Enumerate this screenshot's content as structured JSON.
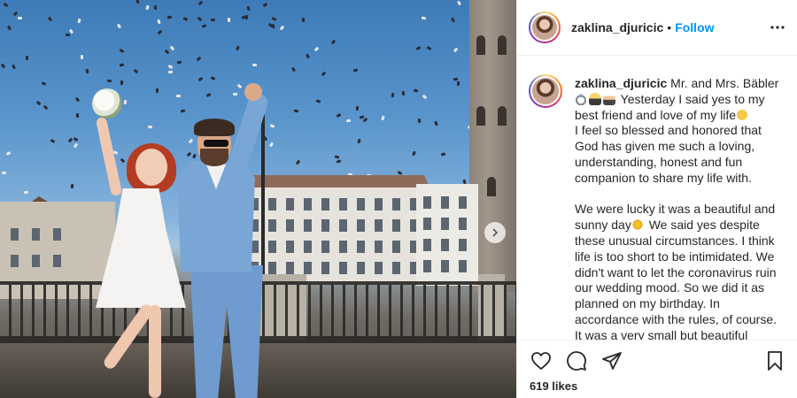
{
  "post": {
    "photo_alt": "",
    "author": {
      "username": "zaklina_djuricic",
      "separator": "•",
      "follow_label": "Follow"
    },
    "caption": {
      "username": "zaklina_djuricic",
      "line_1": "Mr. and Mrs. Bäbler",
      "line_2": "Yesterday I said yes to my best friend and love of my life",
      "line_3": "I feel so blessed and honored that God has given me such a loving, understanding, honest and fun companion to share my life with.",
      "line_4a": "We were lucky it was a beautiful and sunny day",
      "line_4b": "We said yes despite these unusual circumstances. I think life is too short to be intimidated. We didn't want to let the coronavirus ruin our wedding mood. So we did it as planned on my birthday. In accordance with the rules, of course. It was a very small but beautiful",
      "emojis": [
        "ring-icon",
        "groom-emoji-icon",
        "bride-emoji-icon",
        "smiling-face-with-hearts-icon",
        "sun-icon"
      ]
    },
    "likes": "619 likes",
    "icons": {
      "like": "heart-icon",
      "comment": "comment-icon",
      "share": "paper-plane-icon",
      "save": "bookmark-icon",
      "more": "ellipsis-icon",
      "next": "chevron-right-icon"
    }
  }
}
